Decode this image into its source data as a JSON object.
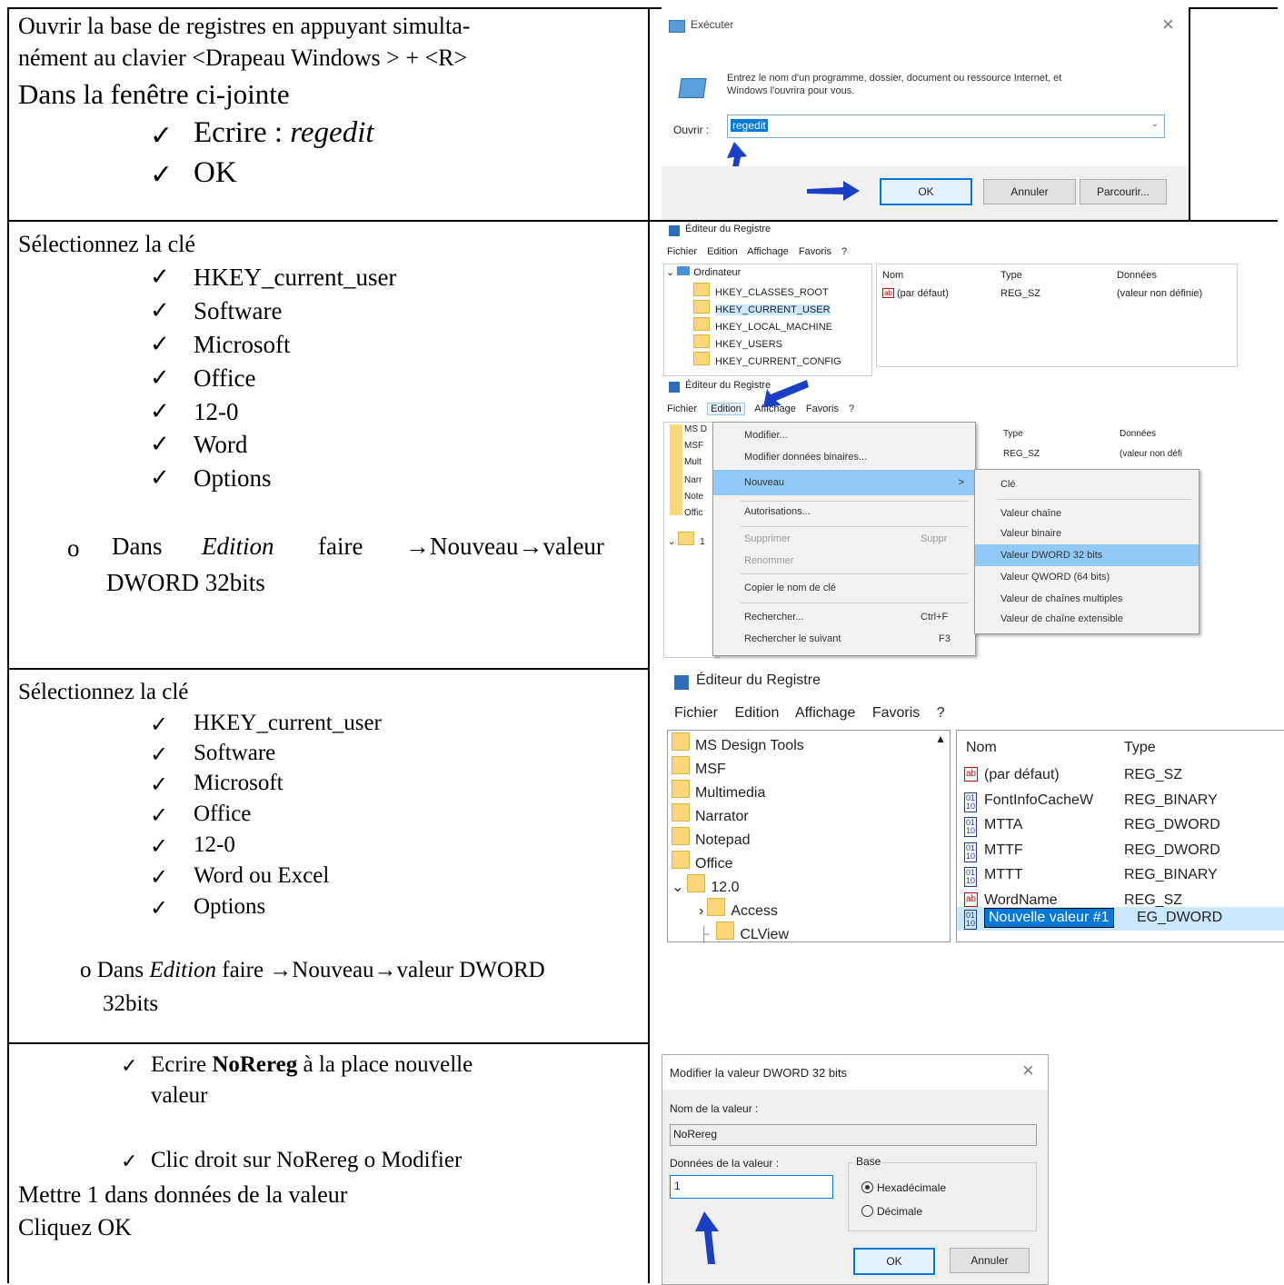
{
  "row1": {
    "instruction_l1": "Ouvrir la base de registres en appuyant simulta-",
    "instruction_l2": "nément au clavier <Drapeau Windows > + <R>",
    "instruction_l3": "Dans la fenêtre ci-jointe",
    "step1_prefix": "Ecrire : ",
    "step1_value": "regedit",
    "step2": "OK",
    "run_dialog": {
      "title": "Exécuter",
      "close": "×",
      "description_l1": "Entrez le nom d'un programme, dossier, document ou ressource Internet, et",
      "description_l2": "Windows l'ouvrira pour vous.",
      "open_label": "Ouvrir :",
      "open_value": "regedit",
      "ok": "OK",
      "cancel": "Annuler",
      "browse": "Parcourir..."
    }
  },
  "row2": {
    "heading": "Sélectionnez la clé",
    "keys": [
      "HKEY_current_user",
      "Software",
      "Microsoft",
      "Office",
      "12-0",
      "Word",
      "Options"
    ],
    "sub_bullet": "o",
    "sub_w1": "Dans",
    "sub_w2": "Edition",
    "sub_w3": "faire",
    "sub_w4": "→Nouveau→valeur",
    "sub_l2": "DWORD 32bits",
    "regedit_top": {
      "title": "Éditeur du Registre",
      "menu": [
        "Fichier",
        "Edition",
        "Affichage",
        "Favoris",
        "?"
      ],
      "computer": "Ordinateur",
      "tree": [
        "HKEY_CLASSES_ROOT",
        "HKEY_CURRENT_USER",
        "HKEY_LOCAL_MACHINE",
        "HKEY_USERS",
        "HKEY_CURRENT_CONFIG"
      ],
      "col_name": "Nom",
      "col_type": "Type",
      "col_data": "Données",
      "row_name": "(par défaut)",
      "row_type": "REG_SZ",
      "row_data": "(valeur non définie)"
    },
    "regedit_menu": {
      "title": "Éditeur du Registre",
      "menu": [
        "Fichier",
        "Edition",
        "Affichage",
        "Favoris",
        "?"
      ],
      "tree_stubs": [
        "MS D",
        "MSF",
        "Mult",
        "Narr",
        "Note",
        "Offic",
        "1"
      ],
      "col_type": "Type",
      "col_data": "Données",
      "row_type": "REG_SZ",
      "row_data": "(valeur non défi",
      "edit_items": [
        "Modifier...",
        "Modifier données binaires...",
        "Nouveau",
        "Autorisations...",
        "Supprimer",
        "Renommer",
        "Copier le nom de clé",
        "Rechercher...",
        "Rechercher le suivant"
      ],
      "shortcut_delete": "Suppr",
      "shortcut_find": "Ctrl+F",
      "shortcut_next": "F3",
      "submenu_arrow": ">",
      "new_items": [
        "Clé",
        "Valeur chaîne",
        "Valeur binaire",
        "Valeur DWORD 32 bits",
        "Valeur QWORD (64 bits)",
        "Valeur de chaînes multiples",
        "Valeur de chaîne extensible"
      ]
    }
  },
  "row3": {
    "heading": "Sélectionnez la clé",
    "keys": [
      "HKEY_current_user",
      "Software",
      "Microsoft",
      "Office",
      "12-0",
      "Word ou Excel",
      "Options"
    ],
    "sub_prefix": "o Dans ",
    "sub_edition": "Edition",
    "sub_rest": " faire →Nouveau→valeur DWORD",
    "sub_l2": "32bits",
    "regedit": {
      "title": "Éditeur du Registre",
      "menu": [
        "Fichier",
        "Edition",
        "Affichage",
        "Favoris",
        "?"
      ],
      "tree": [
        "MS Design Tools",
        "MSF",
        "Multimedia",
        "Narrator",
        "Notepad",
        "Office",
        "12.0",
        "Access",
        "CLView"
      ],
      "col_name": "Nom",
      "col_type": "Type",
      "values": [
        {
          "name": "(par défaut)",
          "type": "REG_SZ",
          "icon": "ab"
        },
        {
          "name": "FontInfoCacheW",
          "type": "REG_BINARY",
          "icon": "bin"
        },
        {
          "name": "MTTA",
          "type": "REG_DWORD",
          "icon": "bin"
        },
        {
          "name": "MTTF",
          "type": "REG_DWORD",
          "icon": "bin"
        },
        {
          "name": "MTTT",
          "type": "REG_BINARY",
          "icon": "bin"
        },
        {
          "name": "WordName",
          "type": "REG_SZ",
          "icon": "ab"
        }
      ],
      "new_value_name": "Nouvelle valeur #1",
      "new_value_type": "EG_DWORD"
    }
  },
  "row4": {
    "step1_pre": "Ecrire ",
    "step1_bold": "NoRereg",
    "step1_post": " à la place nouvelle",
    "step1_l2": "valeur",
    "step2": "Clic droit sur NoRereg o Modifier",
    "line3": "Mettre 1 dans données de la valeur",
    "line4": "Cliquez OK",
    "dialog": {
      "title": "Modifier la valeur DWORD 32 bits",
      "close": "×",
      "name_label": "Nom de la valeur :",
      "name_value": "NoRereg",
      "data_label": "Données de la valeur :",
      "data_value": "1",
      "base_label": "Base",
      "hex": "Hexadécimale",
      "dec": "Décimale",
      "ok": "OK",
      "cancel": "Annuler"
    }
  }
}
